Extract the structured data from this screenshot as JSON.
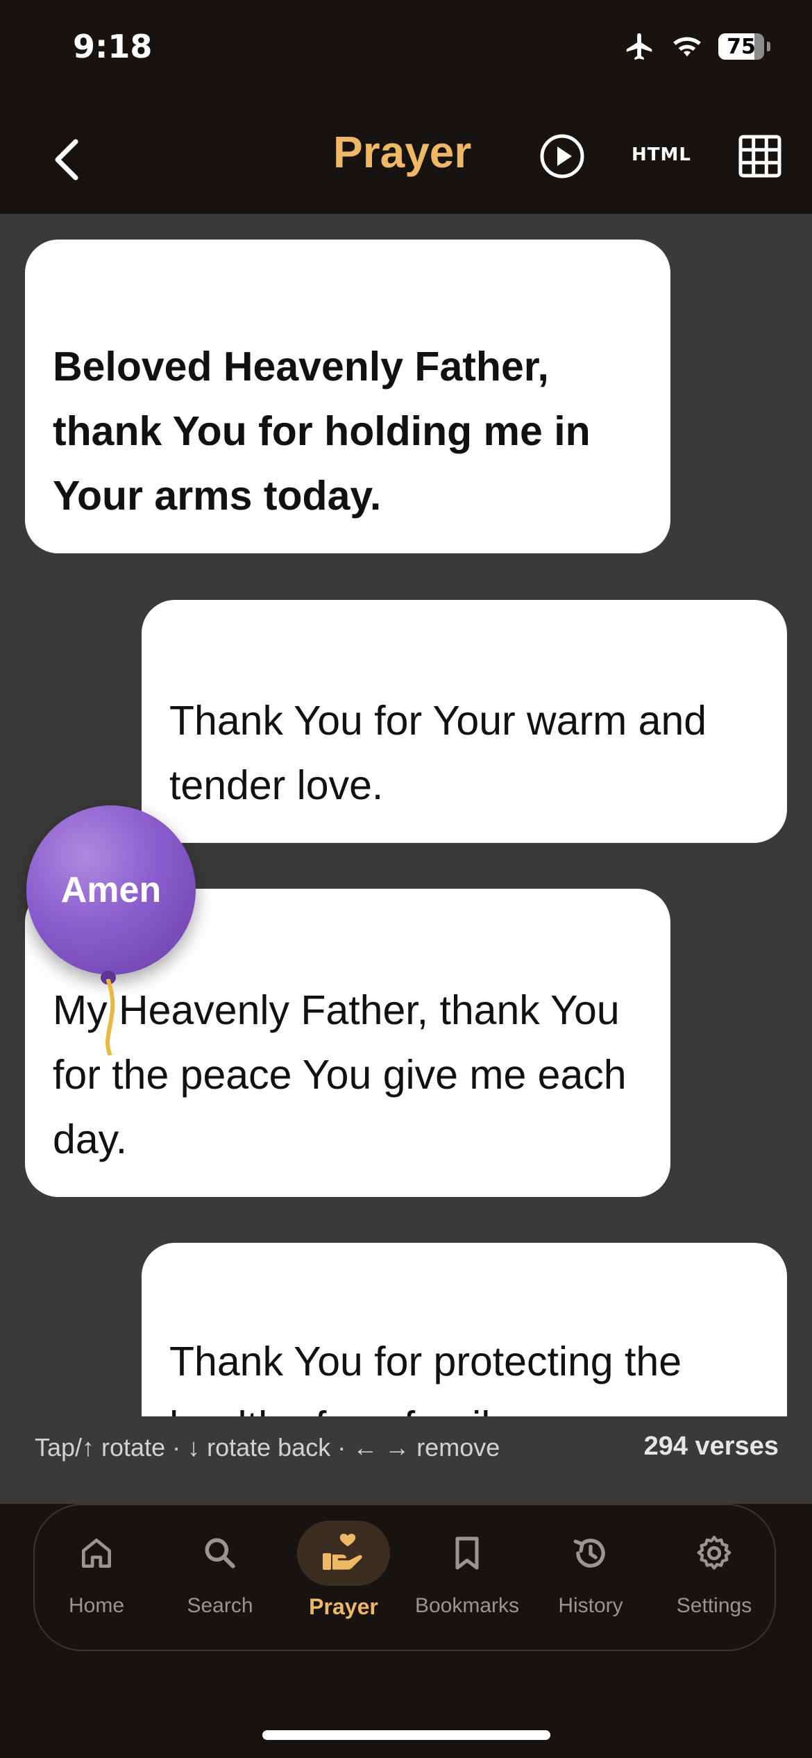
{
  "status": {
    "time": "9:18",
    "battery": "75"
  },
  "nav": {
    "title": "Prayer",
    "html_label": "HTML"
  },
  "messages": [
    {
      "text": "Beloved Heavenly Father, thank You for holding me in Your arms today."
    },
    {
      "text": "Thank You for Your warm and tender love."
    },
    {
      "text": "My Heavenly Father, thank You for the peace You give me each day."
    },
    {
      "text": "Thank You for protecting the health of my family."
    }
  ],
  "balloon": {
    "label": "Amen",
    "color": "#8a5ccd"
  },
  "hint": {
    "text": "Tap/↑ rotate · ↓ rotate back · ← → remove",
    "count": "294 verses"
  },
  "tabs": [
    {
      "label": "Home",
      "icon": "home-icon"
    },
    {
      "label": "Search",
      "icon": "search-icon"
    },
    {
      "label": "Prayer",
      "icon": "praying-hands-heart-icon",
      "active": true
    },
    {
      "label": "Bookmarks",
      "icon": "bookmark-icon"
    },
    {
      "label": "History",
      "icon": "history-icon"
    },
    {
      "label": "Settings",
      "icon": "gear-icon"
    }
  ],
  "colors": {
    "accent": "#F0B764",
    "background": "#161310",
    "content": "#3a3a3b"
  }
}
